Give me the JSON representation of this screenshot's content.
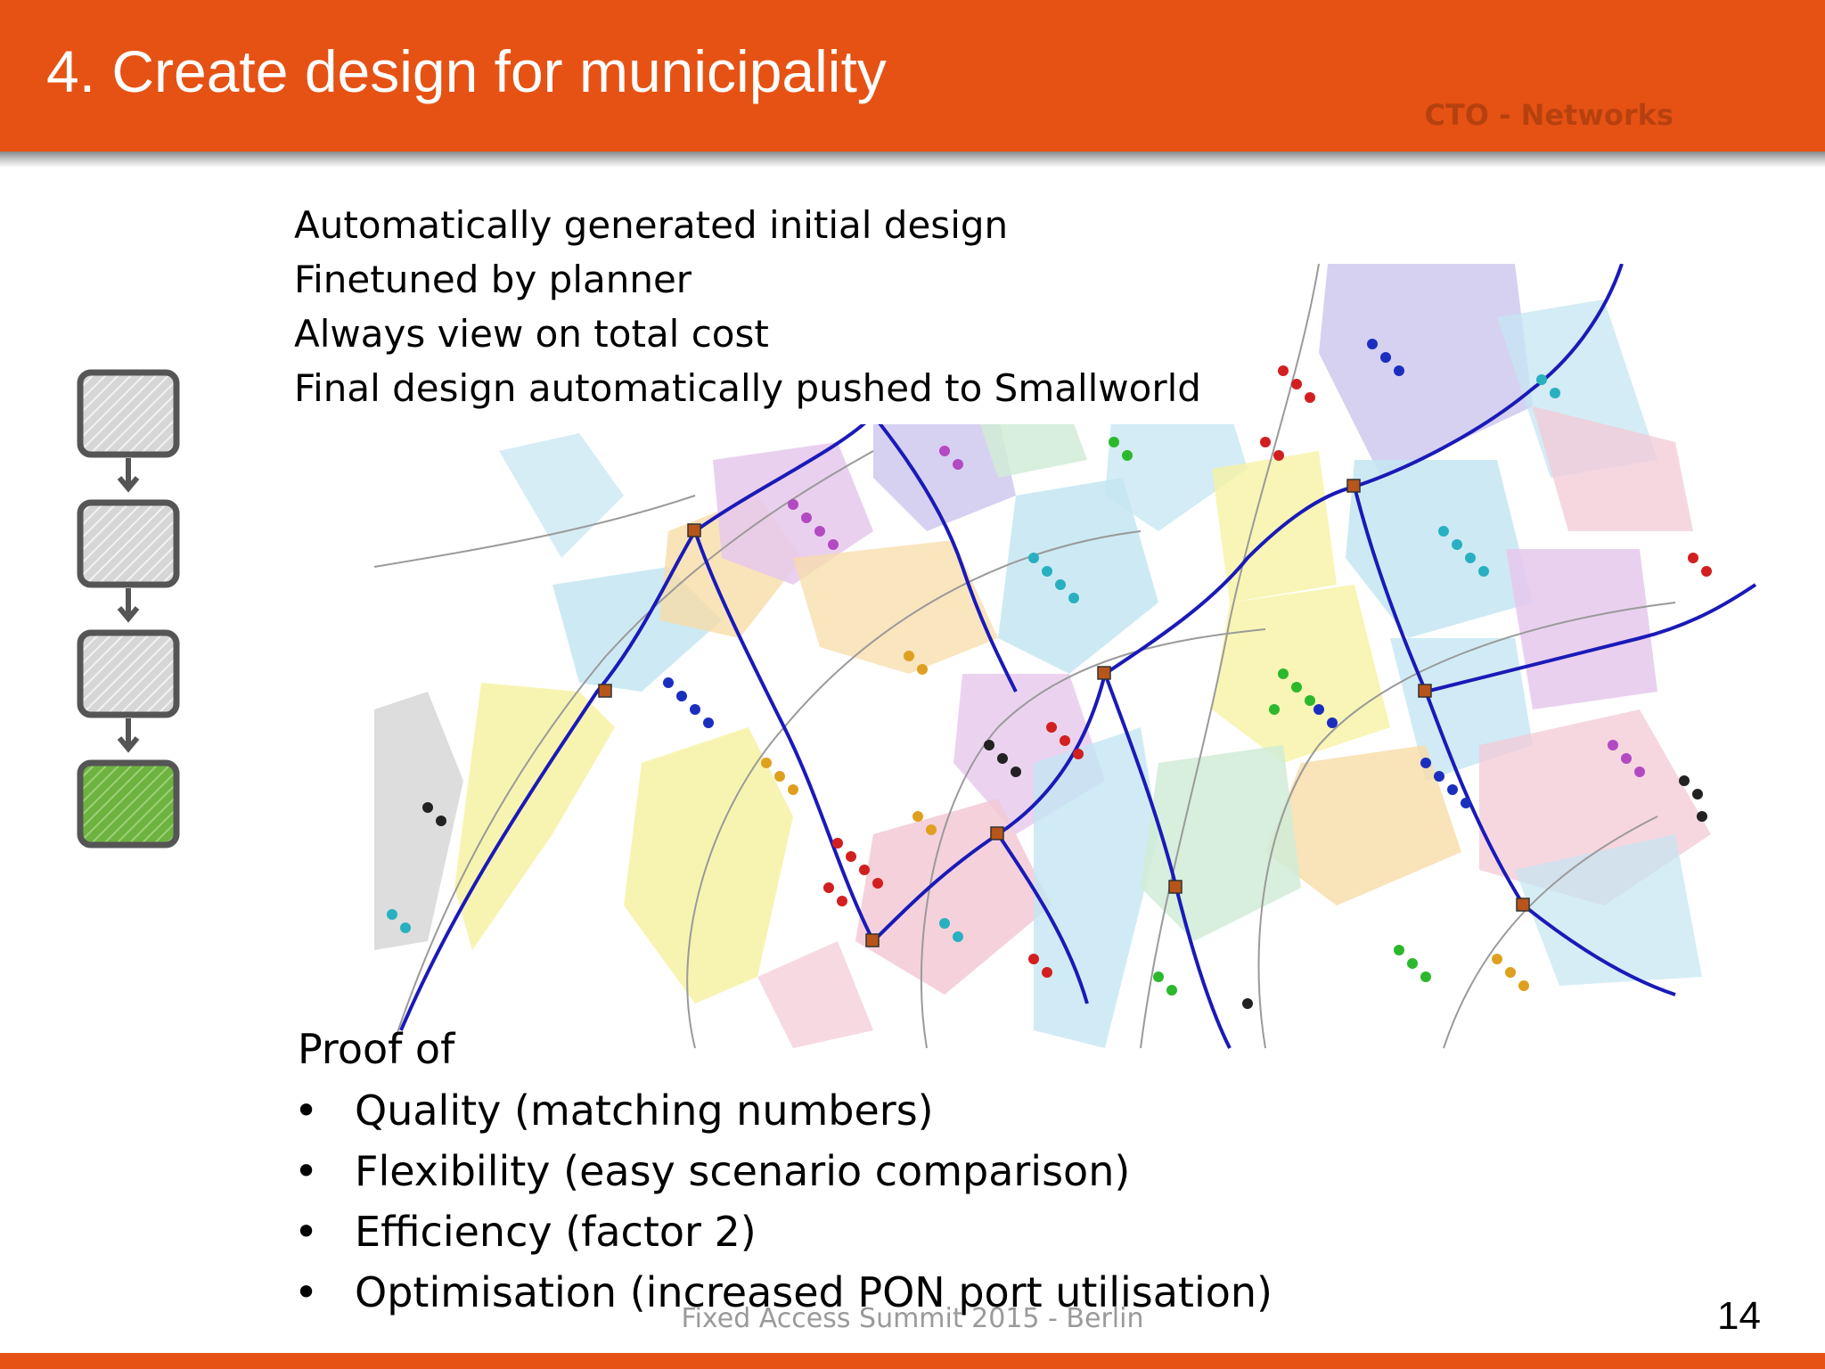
{
  "slide": {
    "title": "4. Create design for municipality",
    "department": "CTO - Networks",
    "intro_lines": [
      "Automatically generated initial design",
      "Finetuned by planner",
      "Always view on total cost",
      "Final design automatically pushed to Smallworld"
    ],
    "proof_heading": "Proof of",
    "proof_items": [
      "Quality (matching numbers)",
      "Flexibility (easy scenario comparison)",
      "Efficiency (factor 2)",
      "Optimisation (increased PON port utilisation)"
    ],
    "footer": "Fixed Access Summit 2015 - Berlin",
    "page_number": "14"
  },
  "process": {
    "steps": 4,
    "active_step": 4,
    "inactive_color": "#d6d6d6",
    "active_color": "#6db33f",
    "border_color": "#555555"
  },
  "colors": {
    "header": "#e65214",
    "department_text": "#b7410e",
    "footer_text": "#9a9a9a"
  },
  "map": {
    "description_icon": "network-design-map",
    "area_colors": [
      "#f6f2a4",
      "#c4e6f2",
      "#e6c8ec",
      "#f3c9d5",
      "#cfc9ef",
      "#d0ecd6",
      "#f7dca8"
    ],
    "route_color": "#1a1ab8",
    "marker_colors": [
      "#d21f1f",
      "#1b2fbf",
      "#2cb82c",
      "#b34ac2",
      "#28b0c0",
      "#222222",
      "#e0a01f"
    ]
  }
}
